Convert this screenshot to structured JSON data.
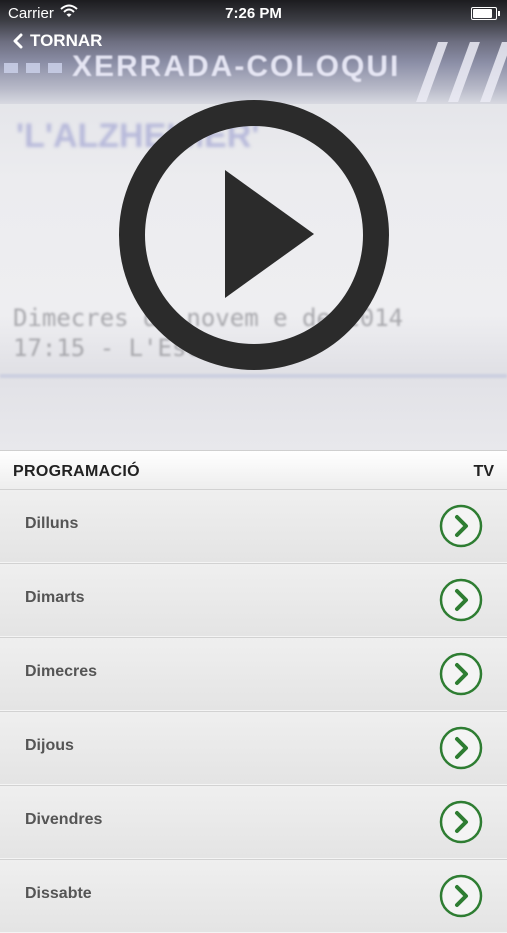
{
  "status_bar": {
    "carrier": "Carrier",
    "time": "7:26 PM",
    "battery_level": 0.9
  },
  "nav": {
    "back_label": "TORNAR"
  },
  "video": {
    "heading": "XERRADA-COLOQUI",
    "subtitle": "'L'ALZHEIMER'",
    "info_line1": "Dimecres   de novem   e de 2014",
    "info_line2": "17:15 - L'Esc",
    "play_color": "#2b2b2b"
  },
  "programacio": {
    "title": "PROGRAMACIÓ",
    "channel": "TV",
    "accent_color": "#2e7d32",
    "days": [
      {
        "label": "Dilluns"
      },
      {
        "label": "Dimarts"
      },
      {
        "label": "Dimecres"
      },
      {
        "label": "Dijous"
      },
      {
        "label": "Divendres"
      },
      {
        "label": "Dissabte"
      }
    ]
  }
}
